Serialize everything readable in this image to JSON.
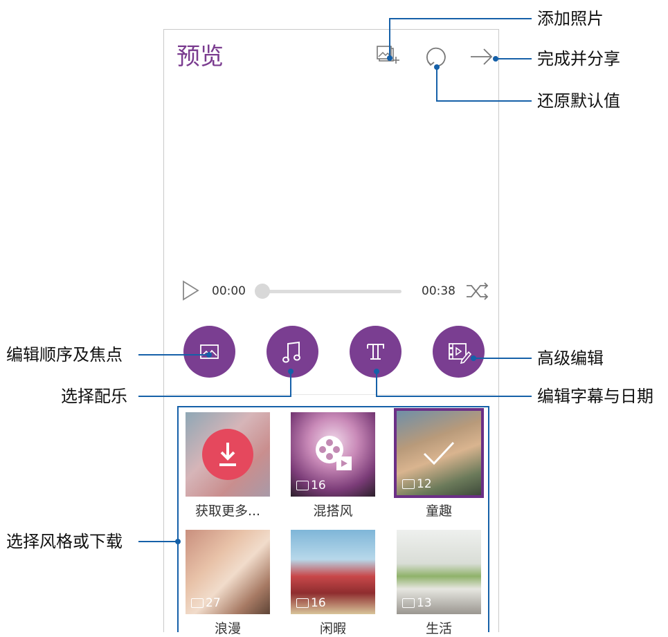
{
  "screen": {
    "title": "预览",
    "toolbar": {
      "add_photo_icon": "add-photo-icon",
      "reset_icon": "refresh-icon",
      "done_icon": "arrow-right-icon"
    },
    "player": {
      "current_time": "00:00",
      "total_time": "00:38",
      "progress": 0
    },
    "edit_buttons": [
      {
        "icon": "image-icon"
      },
      {
        "icon": "music-note-icon"
      },
      {
        "icon": "text-icon"
      },
      {
        "icon": "video-edit-icon"
      }
    ],
    "styles": [
      {
        "caption": "获取更多...",
        "count": ""
      },
      {
        "caption": "混搭风",
        "count": "16"
      },
      {
        "caption": "童趣",
        "count": "12",
        "selected": true
      },
      {
        "caption": "浪漫",
        "count": "27"
      },
      {
        "caption": "闲暇",
        "count": "16"
      },
      {
        "caption": "生活",
        "count": "13"
      }
    ]
  },
  "callouts": {
    "add_photo": "添加照片",
    "done_share": "完成并分享",
    "reset_default": "还原默认值",
    "edit_order_focus": "编辑顺序及焦点",
    "select_music": "选择配乐",
    "advanced_edit": "高级编辑",
    "edit_caption_date": "编辑字幕与日期",
    "select_style": "选择风格或下载"
  },
  "colors": {
    "accent_purple": "#7a3e91",
    "callout_blue": "#1560a8",
    "download_red": "#e5485d"
  }
}
